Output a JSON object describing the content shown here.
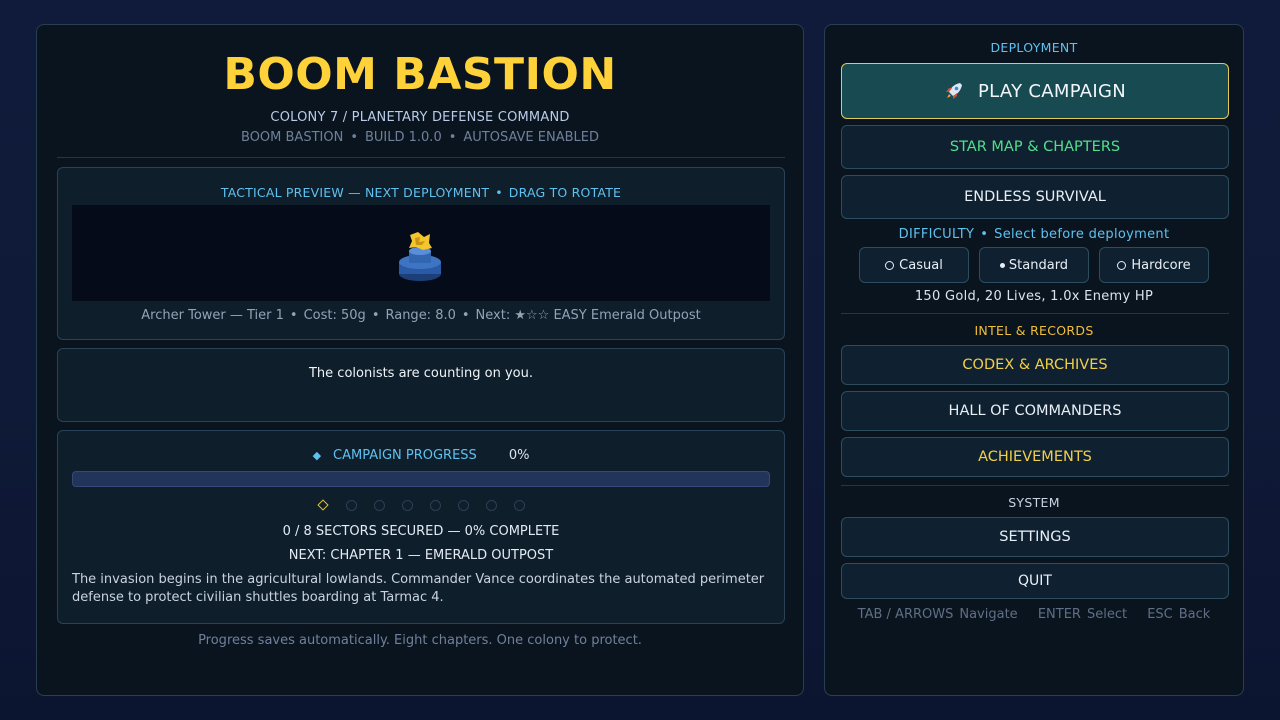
{
  "header": {
    "title": "BOOM BASTION",
    "subtitle": "COLONY 7 / PLANETARY DEFENSE COMMAND",
    "game_name": "BOOM BASTION",
    "build": "BUILD 1.0.0",
    "autosave": "AUTOSAVE ENABLED",
    "separator": "•"
  },
  "preview": {
    "heading": "TACTICAL PREVIEW — NEXT DEPLOYMENT",
    "hint": "DRAG TO ROTATE",
    "tower_name": "Archer Tower — Tier 1",
    "cost": "Cost: 50g",
    "range": "Range: 8.0",
    "next": "Next: ★☆☆ EASY Emerald Outpost"
  },
  "message": "The colonists are counting on you.",
  "progress": {
    "label": "CAMPAIGN PROGRESS",
    "percent_text": "0%",
    "fraction": 0,
    "sectors_total": 8,
    "sectors_secured": 0,
    "sectors_line": "0 / 8 SECTORS SECURED — 0% COMPLETE",
    "next_line": "NEXT: CHAPTER 1 — EMERALD OUTPOST",
    "story": "The invasion begins in the agricultural lowlands. Commander Vance coordinates the automated perimeter defense to protect civilian shuttles boarding at Tarmac 4."
  },
  "footer_note": "Progress saves automatically. Eight chapters. One colony to protect.",
  "menu": {
    "deployment_label": "DEPLOYMENT",
    "play": "PLAY CAMPAIGN",
    "play_icon": "rocket-icon",
    "starmap": "STAR MAP & CHAPTERS",
    "endless": "ENDLESS SURVIVAL",
    "difficulty_label": "DIFFICULTY",
    "difficulty_hint": "Select before deployment",
    "difficulties": [
      "Casual",
      "Standard",
      "Hardcore"
    ],
    "selected_difficulty": "Standard",
    "difficulty_info": "150 Gold, 20 Lives, 1.0x Enemy HP",
    "intel_label": "INTEL & RECORDS",
    "codex": "CODEX & ARCHIVES",
    "hall": "HALL OF COMMANDERS",
    "achievements": "ACHIEVEMENTS",
    "system_label": "SYSTEM",
    "settings": "SETTINGS",
    "quit": "QUIT"
  },
  "hints": [
    {
      "key": "TAB / ARROWS",
      "action": "Navigate"
    },
    {
      "key": "ENTER",
      "action": "Select"
    },
    {
      "key": "ESC",
      "action": "Back"
    }
  ],
  "colors": {
    "title": "#ffd23a",
    "accent": "#5fc1f0",
    "gold": "#f2cf4a",
    "green": "#4fe08a"
  }
}
